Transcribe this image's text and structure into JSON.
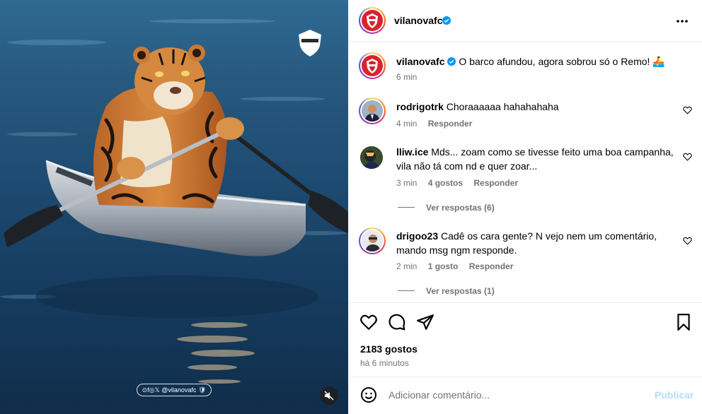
{
  "post": {
    "author": "vilanovafc",
    "caption_author": "vilanovafc",
    "caption": "O barco afundou, agora sobrou só o Remo! 🚣",
    "caption_time": "6 min",
    "likes": "2183 gostos",
    "posted": "há 6 minutos"
  },
  "media": {
    "watermark": "⊙f◎𝕏 @vilanovafc 🛡",
    "club_badge_icon": "shield-badge-icon"
  },
  "comments": [
    {
      "user": "rodrigotrk",
      "text": "Choraaaaaa hahahahaha",
      "time": "4 min",
      "likes": "",
      "reply": "Responder"
    },
    {
      "user": "lliw.ice",
      "text": "Mds... zoam como se tivesse feito uma boa campanha, vila não tá com nd e quer zoar...",
      "time": "3 min",
      "likes": "4 gostos",
      "reply": "Responder",
      "view_replies": "Ver respostas (6)"
    },
    {
      "user": "drigoo23",
      "text": "Cadê os cara gente? N vejo nem um comentário, mando msg ngm responde.",
      "time": "2 min",
      "likes": "1 gosto",
      "reply": "Responder",
      "view_replies": "Ver respostas (1)"
    }
  ],
  "add_comment": {
    "placeholder": "Adicionar comentário...",
    "publish": "Publicar"
  },
  "colors": {
    "accent_disabled": "#b3dbff",
    "verified": "#0095f6",
    "club_red": "#d9232e"
  }
}
